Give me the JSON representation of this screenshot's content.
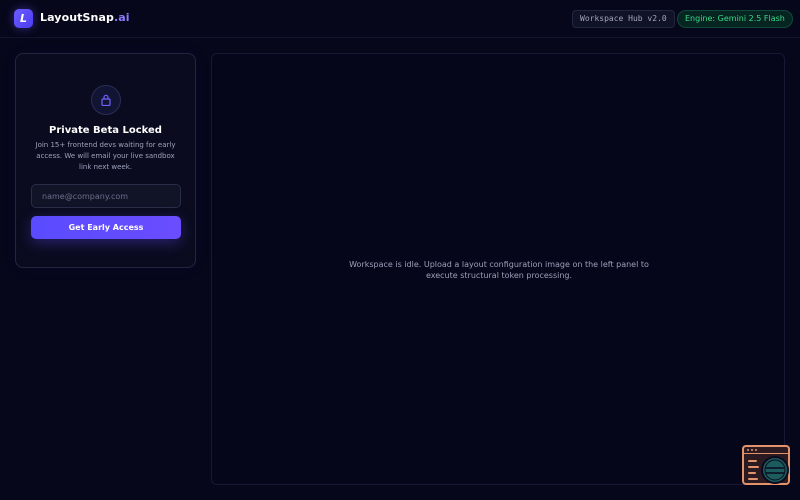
{
  "header": {
    "logo_letter": "L",
    "brand_main": "LayoutSnap",
    "brand_suffix": ".ai",
    "hub_badge": "Workspace Hub v2.0",
    "engine_badge": "Engine: Gemini 2.5 Flash"
  },
  "beta_panel": {
    "icon": "lock-icon",
    "title": "Private Beta Locked",
    "description": "Join 15+ frontend devs waiting for early access. We will email your live sandbox link next week.",
    "email_placeholder": "name@company.com",
    "email_value": "",
    "cta_label": "Get Early Access"
  },
  "workspace": {
    "idle_message": "Workspace is idle. Upload a layout configuration image on the left panel to execute structural token processing."
  },
  "floating_widget": {
    "icon": "browser-search-icon"
  },
  "colors": {
    "background": "#06071a",
    "accent": "#5a4bff",
    "engine_green": "#39d98a",
    "widget_orange": "#e2936a"
  }
}
